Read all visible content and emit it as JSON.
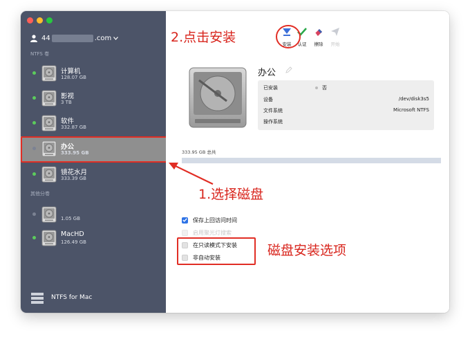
{
  "account": {
    "prefix": "44",
    "suffix": ".com"
  },
  "sections": {
    "ntfs": "NTFS 卷",
    "other": "其他分卷"
  },
  "volumes": [
    {
      "name": "计算机",
      "size": "128.07 GB"
    },
    {
      "name": "影视",
      "size": "3 TB"
    },
    {
      "name": "软件",
      "size": "332.87 GB"
    },
    {
      "name": "办公",
      "size": "333.95 GB"
    },
    {
      "name": "镜花水月",
      "size": "333.39 GB"
    }
  ],
  "other_volumes": [
    {
      "name": "",
      "size": "1.05 GB"
    },
    {
      "name": "MacHD",
      "size": "126.49 GB"
    }
  ],
  "footer": {
    "label": "NTFS for Mac"
  },
  "toolbar": {
    "mount": "安装",
    "verify": "认证",
    "erase": "擦除",
    "open": "开始"
  },
  "detail": {
    "title": "办公",
    "rows": [
      {
        "key": "已安装",
        "value": "否"
      },
      {
        "key": "设备",
        "value": "/dev/disk3s5"
      },
      {
        "key": "文件系统",
        "value": "Microsoft NTFS"
      },
      {
        "key": "操作系统",
        "value": ""
      }
    ],
    "capacity_label": "333.95 GB 总共",
    "capacity_used_fraction": 0.0
  },
  "options": [
    {
      "label": "保存上回访问时间",
      "checked": true,
      "disabled": false
    },
    {
      "label": "启用聚光灯搜索",
      "checked": false,
      "disabled": true
    },
    {
      "label": "在只读模式下安装",
      "checked": false,
      "disabled": false
    },
    {
      "label": "非自动安装",
      "checked": false,
      "disabled": false
    }
  ],
  "annotations": {
    "step2": "2.点击安装",
    "step1": "1.选择磁盘",
    "options": "磁盘安装选项"
  },
  "colors": {
    "sidebar": "#4c5468",
    "selected": "#8f8f8f",
    "annotation": "#d8241c",
    "accent": "#2e73e6"
  }
}
